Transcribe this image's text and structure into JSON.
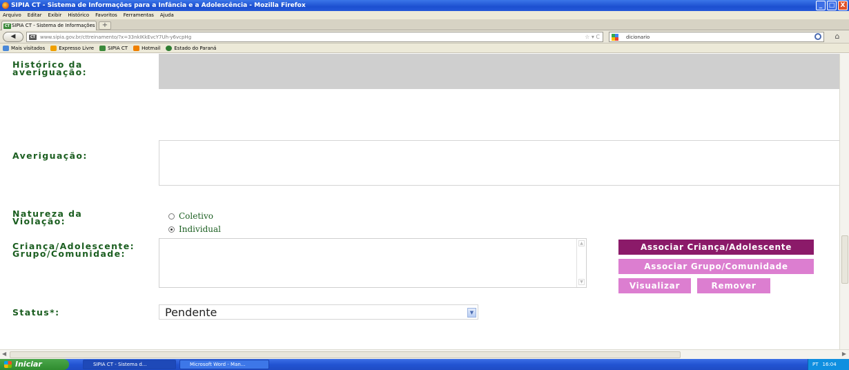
{
  "window": {
    "title": "SIPIA CT - Sistema de Informações para a Infância e a Adolescência - Mozilla Firefox",
    "min_label": "_",
    "max_label": "□",
    "close_label": "X"
  },
  "menu": [
    "Arquivo",
    "Editar",
    "Exibir",
    "Histórico",
    "Favoritos",
    "Ferramentas",
    "Ajuda"
  ],
  "tab": {
    "title": "SIPIA CT - Sistema de Informações para a I...",
    "icon_text": "CT",
    "new_tab_label": "+"
  },
  "nav": {
    "url": "www.sipia.gov.br/cttreinamento/?x=33nkIKkEvcY7Uh-y6vcpHg",
    "url_tools": "☆ ▾ C",
    "search_value": "dicionario",
    "back_label": "◀"
  },
  "bookmarks": [
    {
      "label": "Mais visitados",
      "color": "#4a88d8"
    },
    {
      "label": "Expresso Livre",
      "color": "#f0a000"
    },
    {
      "label": "SIPIA CT",
      "color": "#3c8a3c"
    },
    {
      "label": "Hotmail",
      "color": "#f08000"
    },
    {
      "label": "Estado do Paraná",
      "color": "#2e7d32"
    }
  ],
  "form": {
    "historico_label": "Histórico da\naveriguação:",
    "averiguacao_label": "Averiguação:",
    "natureza_label": "Natureza da\nViolação:",
    "natureza_options": [
      {
        "label": "Coletivo",
        "checked": false
      },
      {
        "label": "Individual",
        "checked": true
      }
    ],
    "crianca_label": "Criança/Adolescente:\nGrupo/Comunidade:",
    "status_label": "Status*:",
    "status_value": "Pendente",
    "btn_associar_crianca": "Associar Criança/Adolescente",
    "btn_associar_grupo": "Associar Grupo/Comunidade",
    "btn_visualizar": "Visualizar",
    "btn_remover": "Remover"
  },
  "taskbar": {
    "start_label": "Iniciar",
    "items": [
      "SIPIA CT - Sistema d...",
      "Microsoft Word - Man..."
    ],
    "tray_lang": "PT",
    "tray_time": "16:04"
  },
  "colors": {
    "label_green": "#1b5e20",
    "button_dark": "#8b1a69",
    "button_light": "#dc7ed0",
    "gray_field": "#cfcfcf"
  }
}
